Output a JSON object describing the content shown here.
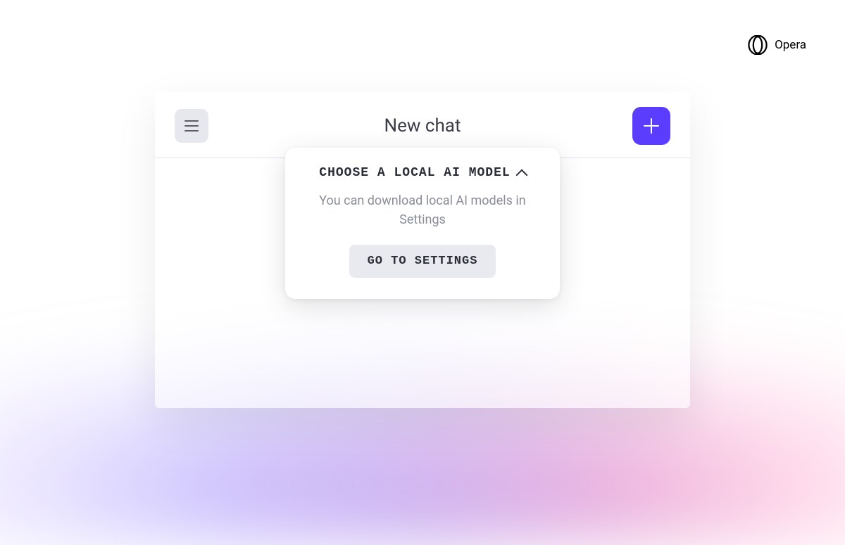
{
  "brand": {
    "name": "Opera"
  },
  "header": {
    "title": "New chat"
  },
  "dropdown": {
    "title": "CHOOSE A LOCAL AI MODEL",
    "description": "You can download local AI models in Settings",
    "button_label": "GO TO SETTINGS"
  },
  "colors": {
    "accent": "#5b3dff",
    "text_primary": "#2a2d38",
    "text_secondary": "#8a8d98",
    "button_bg": "#e8eaef"
  }
}
